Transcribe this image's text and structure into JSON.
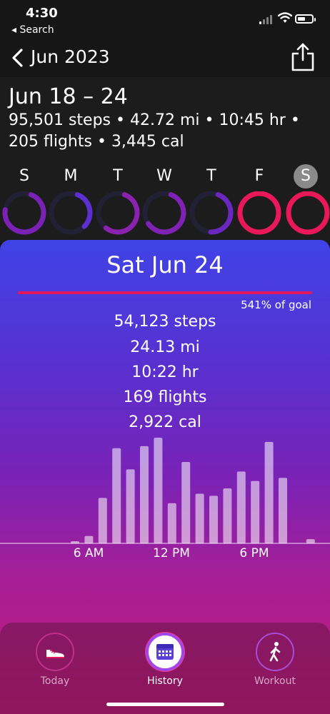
{
  "status_bar": {
    "time": "4:30",
    "back_app": "◂ Search"
  },
  "nav": {
    "title": "Jun 2023"
  },
  "week": {
    "title": "Jun 18 – 24",
    "summary_line1": "95,501 steps • 42.72 mi • 10:45 hr •",
    "summary_line2": "205 flights • 3,445 cal",
    "days": [
      {
        "label": "S",
        "progress": 0.72,
        "color": "#7a22b6",
        "complete": false
      },
      {
        "label": "M",
        "progress": 0.32,
        "color": "#5b2fd0",
        "complete": false
      },
      {
        "label": "T",
        "progress": 0.55,
        "color": "#8a22b0",
        "complete": false
      },
      {
        "label": "W",
        "progress": 0.6,
        "color": "#7f22b4",
        "complete": false
      },
      {
        "label": "T",
        "progress": 0.45,
        "color": "#6a28c0",
        "complete": false
      },
      {
        "label": "F",
        "progress": 1.0,
        "color": "#e8185a",
        "complete": true
      },
      {
        "label": "S",
        "progress": 1.0,
        "color": "#e8185a",
        "complete": true
      }
    ],
    "selected_day_index": 6
  },
  "detail": {
    "day_title": "Sat Jun 24",
    "goal_pct": "541% of goal",
    "steps": "54,123 steps",
    "distance": "24.13 mi",
    "duration": "10:22 hr",
    "flights": "169 flights",
    "calories": "2,922 cal"
  },
  "chart_data": {
    "type": "bar",
    "x_tick_labels": [
      "6 AM",
      "12 PM",
      "6 PM"
    ],
    "hours": [
      0,
      1,
      2,
      3,
      4,
      5,
      6,
      7,
      8,
      9,
      10,
      11,
      12,
      13,
      14,
      15,
      16,
      17,
      18,
      19,
      20,
      21,
      22,
      23
    ],
    "values": [
      0,
      0,
      0,
      0,
      0,
      0.02,
      0.07,
      0.43,
      0.9,
      0.7,
      0.92,
      1.0,
      0.38,
      0.77,
      0.47,
      0.45,
      0.52,
      0.68,
      0.59,
      0.96,
      0.62,
      0,
      0.04,
      0
    ],
    "value_scale": "relative to tallest bar"
  },
  "tabs": [
    {
      "label": "Today",
      "icon": "sneaker-icon",
      "active": false
    },
    {
      "label": "History",
      "icon": "calendar-icon",
      "active": true
    },
    {
      "label": "Workout",
      "icon": "walking-person-icon",
      "active": false
    }
  ]
}
